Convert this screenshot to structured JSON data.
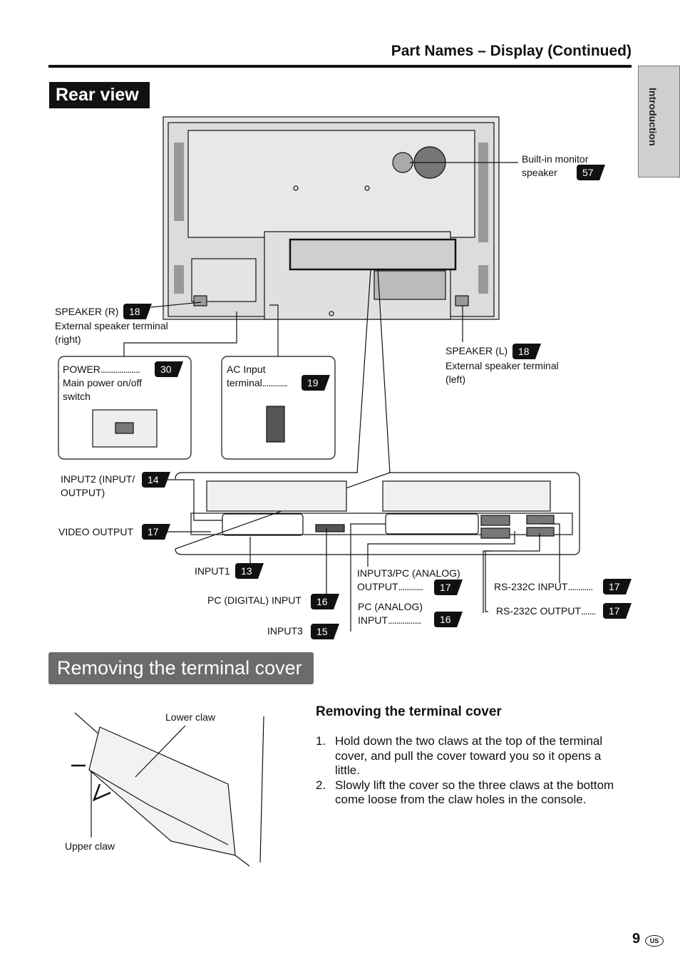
{
  "header": {
    "title": "Part Names – Display (Continued)"
  },
  "side_tab": {
    "label": "Introduction"
  },
  "rear_view": {
    "title": "Rear view",
    "callouts": {
      "speaker_builtin": {
        "label": "Built-in monitor",
        "label2": "speaker",
        "page": "57"
      },
      "speaker_r": {
        "label": "SPEAKER (R)",
        "page": "18",
        "desc": "External speaker terminal",
        "desc2": "(right)"
      },
      "speaker_l": {
        "label": "SPEAKER (L)",
        "page": "18",
        "desc": "External speaker terminal",
        "desc2": "(left)"
      },
      "power": {
        "label": "POWER",
        "dots": "...................",
        "page": "30",
        "desc": "Main power on/off",
        "desc2": "switch"
      },
      "ac_input": {
        "label": "AC Input",
        "label2": "terminal",
        "dots": "............",
        "page": "19"
      },
      "input2": {
        "label": "INPUT2 (INPUT/",
        "label2": "OUTPUT)",
        "page": "14"
      },
      "video_output": {
        "label": "VIDEO OUTPUT",
        "page": "17"
      },
      "input1": {
        "label": "INPUT1",
        "page": "13"
      },
      "pc_digital": {
        "label": "PC (DIGITAL) INPUT",
        "page": "16"
      },
      "input3": {
        "label": "INPUT3",
        "page": "15"
      },
      "input3_pc_out": {
        "label": "INPUT3/PC (ANALOG)",
        "label2": "OUTPUT",
        "dots": "............",
        "page": "17"
      },
      "pc_analog_in": {
        "label": "PC (ANALOG)",
        "label2": "INPUT",
        "dots": "................",
        "page": "16"
      },
      "rs232c_in": {
        "label": "RS-232C INPUT",
        "dots": "............",
        "page": "17"
      },
      "rs232c_out": {
        "label": "RS-232C OUTPUT",
        "dots": ".......",
        "page": "17"
      }
    }
  },
  "removing": {
    "banner": "Removing the terminal cover",
    "subheading": "Removing the terminal cover",
    "steps": [
      {
        "num": "1.",
        "text": "Hold down the two claws at the top of the terminal",
        "text2": "cover, and pull the cover toward you so it opens a",
        "text3": "little."
      },
      {
        "num": "2.",
        "text": "Slowly lift the cover so the three claws at the bottom",
        "text2": "come loose from the claw holes in the console."
      }
    ],
    "figure": {
      "lower_claw": "Lower claw",
      "upper_claw": "Upper claw"
    }
  },
  "footer": {
    "page_number": "9",
    "region": "US"
  }
}
